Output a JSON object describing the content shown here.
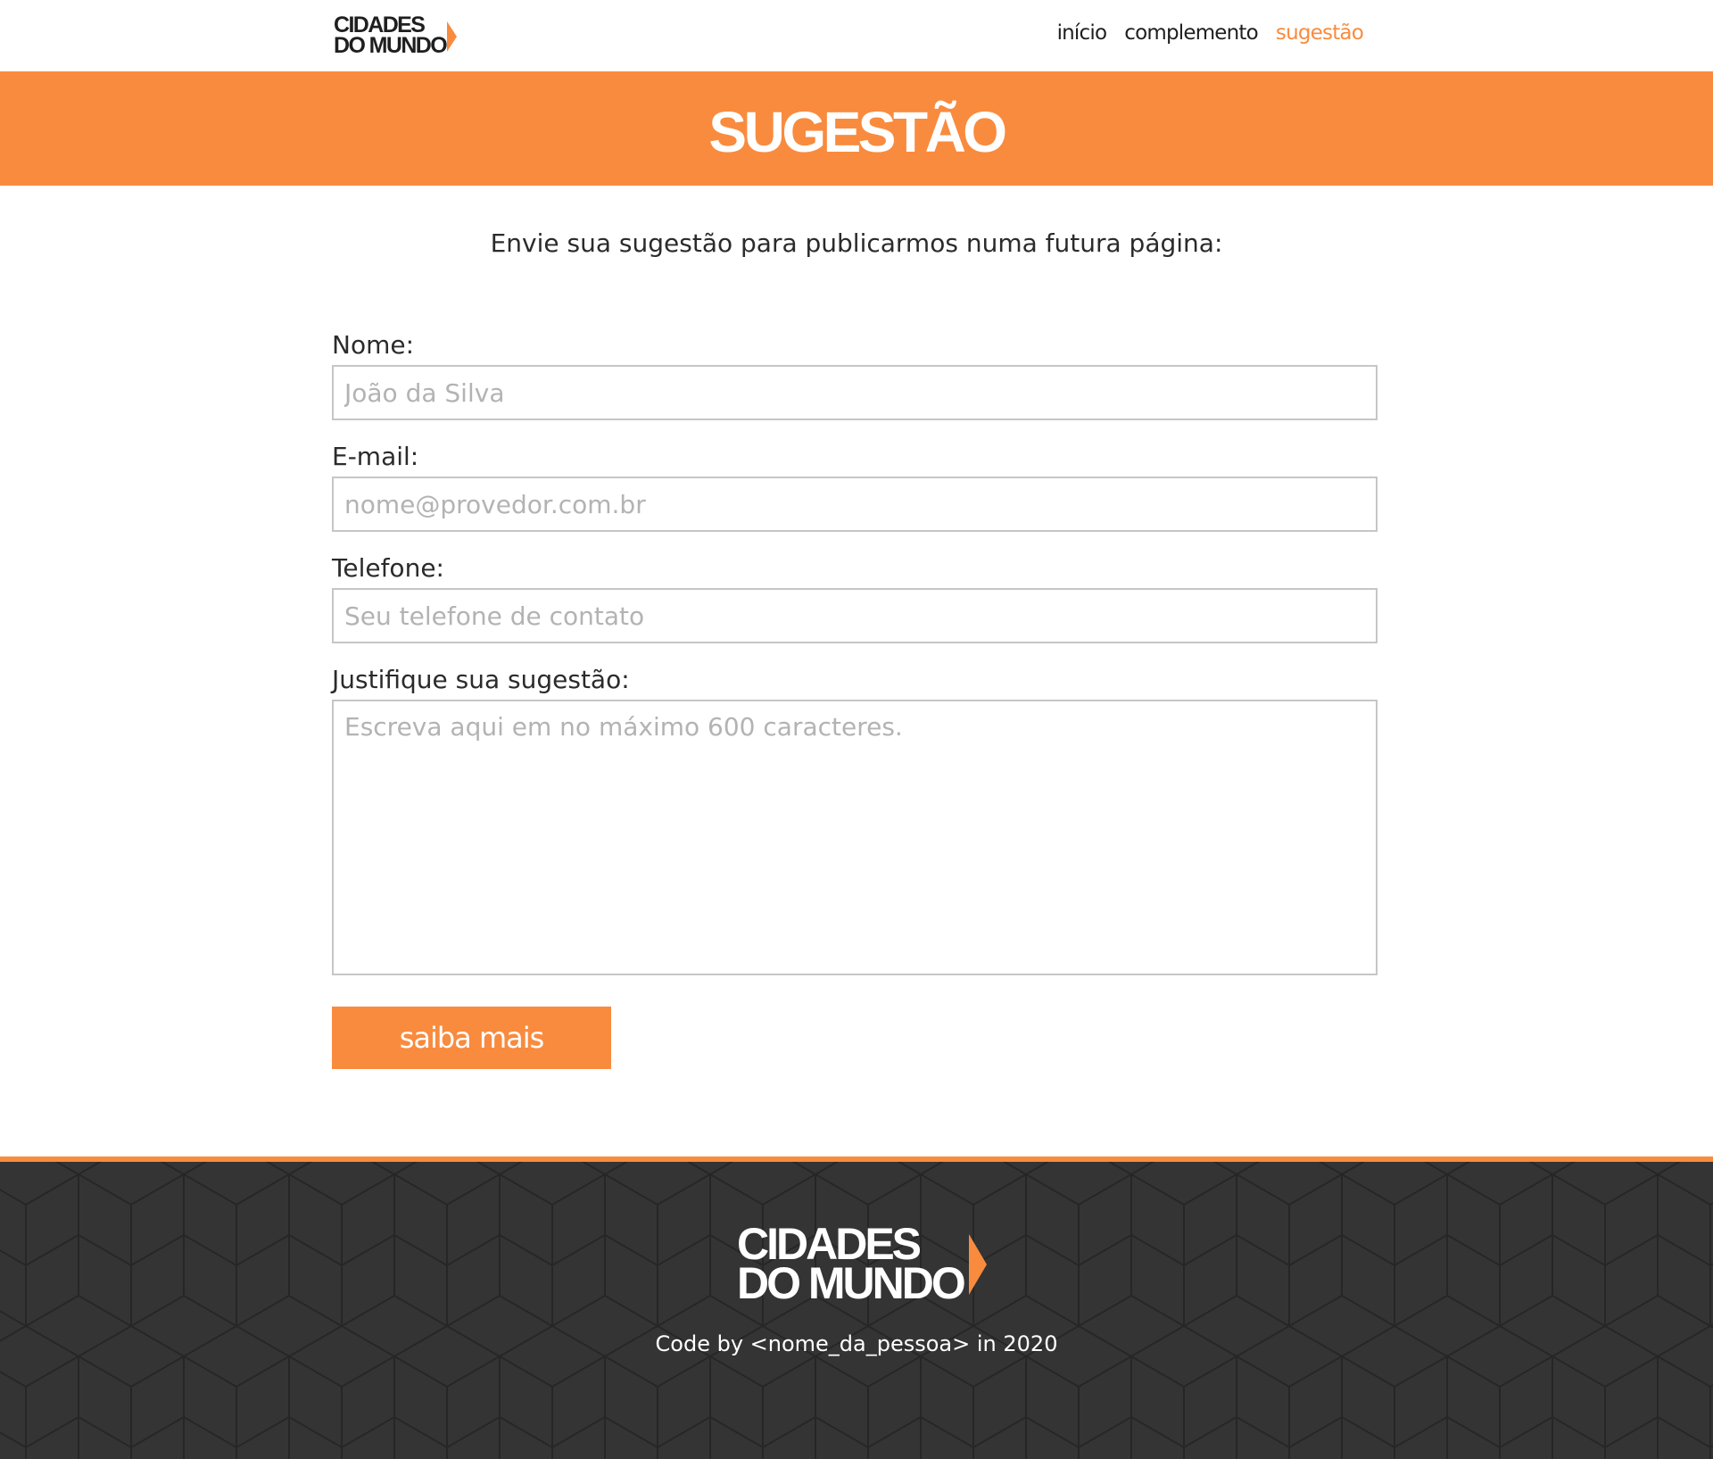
{
  "header": {
    "logo_line1": "CIDADES",
    "logo_line2": "DO MUNDO",
    "logo_icon": "chevron-right-icon",
    "nav": [
      {
        "label": "início",
        "active": false
      },
      {
        "label": "complemento",
        "active": false
      },
      {
        "label": "sugestão",
        "active": true
      }
    ]
  },
  "banner": {
    "title": "SUGESTÃO"
  },
  "main": {
    "intro": "Envie sua sugestão para publicarmos numa futura página:",
    "form": {
      "name_label": "Nome:",
      "name_placeholder": "João da Silva",
      "email_label": "E-mail:",
      "email_placeholder": "nome@provedor.com.br",
      "phone_label": "Telefone:",
      "phone_placeholder": "Seu telefone de contato",
      "justify_label": "Justifique sua sugestão:",
      "justify_placeholder": "Escreva aqui em no máximo 600 caracteres.",
      "submit_label": "saiba mais"
    }
  },
  "footer": {
    "logo_line1": "CIDADES",
    "logo_line2": "DO MUNDO",
    "credit": "Code by <nome_da_pessoa> in 2020"
  },
  "colors": {
    "accent": "#f98b3e",
    "footer_bg": "#343434",
    "text": "#2b2b2b",
    "input_border": "#c6c6c6",
    "placeholder": "#b3b3b3"
  }
}
